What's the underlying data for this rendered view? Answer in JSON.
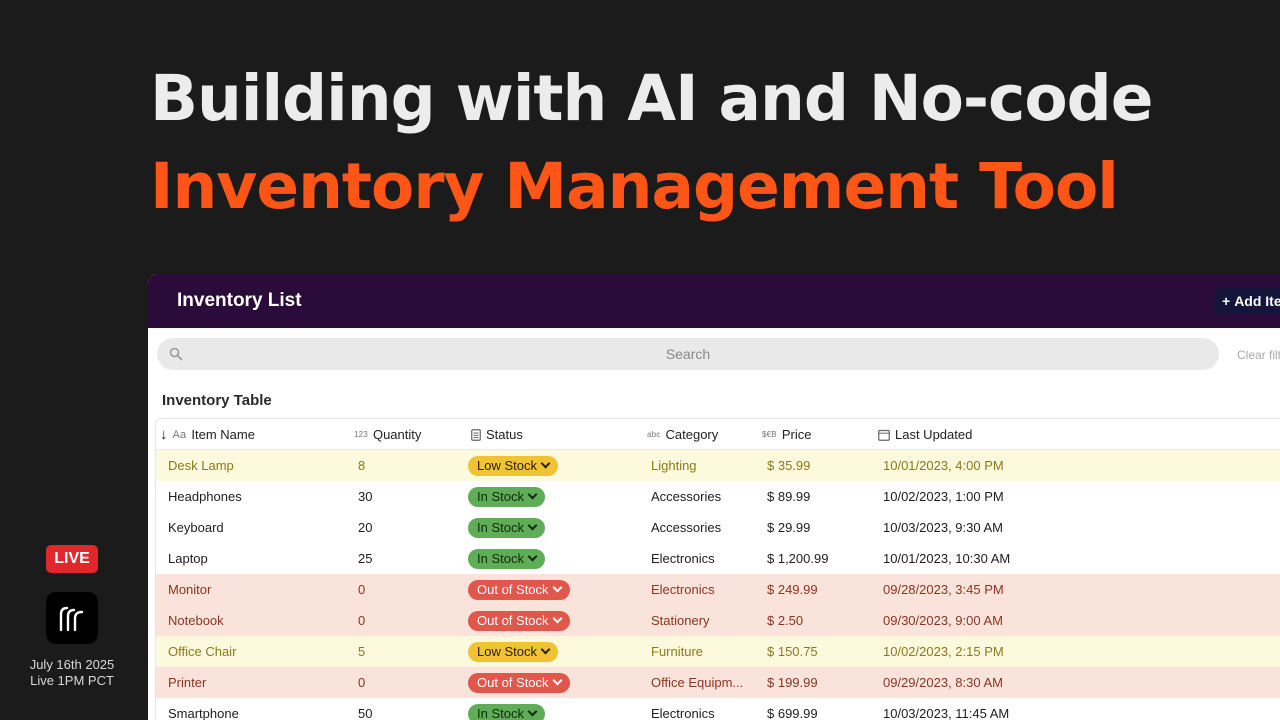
{
  "headline": {
    "line1": "Building with AI and No-code",
    "line2": "Inventory Management Tool"
  },
  "live": {
    "badge": "LIVE",
    "date": "July 16th 2025",
    "time": "Live 1PM PCT"
  },
  "app": {
    "title": "Inventory List",
    "add_button": "Add Ite",
    "search_placeholder": "Search",
    "clear_filters": "Clear filt",
    "table_title": "Inventory Table"
  },
  "columns": [
    {
      "tag": "Aa",
      "label": "Item Name"
    },
    {
      "tag": "123",
      "label": "Quantity"
    },
    {
      "tag": "",
      "label": "Status"
    },
    {
      "tag": "abc",
      "label": "Category"
    },
    {
      "tag": "$€B",
      "label": "Price"
    },
    {
      "tag": "",
      "label": "Last Updated"
    }
  ],
  "rows": [
    {
      "name": "Desk Lamp",
      "qty": "8",
      "status": "Low Stock",
      "kind": "low",
      "category": "Lighting",
      "price": "$ 35.99",
      "updated": "10/01/2023, 4:00 PM"
    },
    {
      "name": "Headphones",
      "qty": "30",
      "status": "In Stock",
      "kind": "ok",
      "category": "Accessories",
      "price": "$ 89.99",
      "updated": "10/02/2023, 1:00 PM"
    },
    {
      "name": "Keyboard",
      "qty": "20",
      "status": "In Stock",
      "kind": "ok",
      "category": "Accessories",
      "price": "$ 29.99",
      "updated": "10/03/2023, 9:30 AM"
    },
    {
      "name": "Laptop",
      "qty": "25",
      "status": "In Stock",
      "kind": "ok",
      "category": "Electronics",
      "price": "$ 1,200.99",
      "updated": "10/01/2023, 10:30 AM"
    },
    {
      "name": "Monitor",
      "qty": "0",
      "status": "Out of Stock",
      "kind": "out",
      "category": "Electronics",
      "price": "$ 249.99",
      "updated": "09/28/2023, 3:45 PM"
    },
    {
      "name": "Notebook",
      "qty": "0",
      "status": "Out of Stock",
      "kind": "out",
      "category": "Stationery",
      "price": "$ 2.50",
      "updated": "09/30/2023, 9:00 AM"
    },
    {
      "name": "Office Chair",
      "qty": "5",
      "status": "Low Stock",
      "kind": "low",
      "category": "Furniture",
      "price": "$ 150.75",
      "updated": "10/02/2023, 2:15 PM"
    },
    {
      "name": "Printer",
      "qty": "0",
      "status": "Out of Stock",
      "kind": "out",
      "category": "Office Equipm...",
      "price": "$ 199.99",
      "updated": "09/29/2023, 8:30 AM"
    },
    {
      "name": "Smartphone",
      "qty": "50",
      "status": "In Stock",
      "kind": "ok",
      "category": "Electronics",
      "price": "$ 699.99",
      "updated": "10/03/2023, 11:45 AM"
    }
  ],
  "colors": {
    "background": "#1b1b1b",
    "headline_white": "#ececec",
    "headline_orange": "#ff5516",
    "app_header": "#2a0b3a",
    "low_row": "#fdf9dd",
    "out_row": "#fae3da",
    "pill_low": "#f1c232",
    "pill_ok": "#5fad56",
    "pill_out": "#e2574c",
    "live_red": "#e0282c"
  }
}
